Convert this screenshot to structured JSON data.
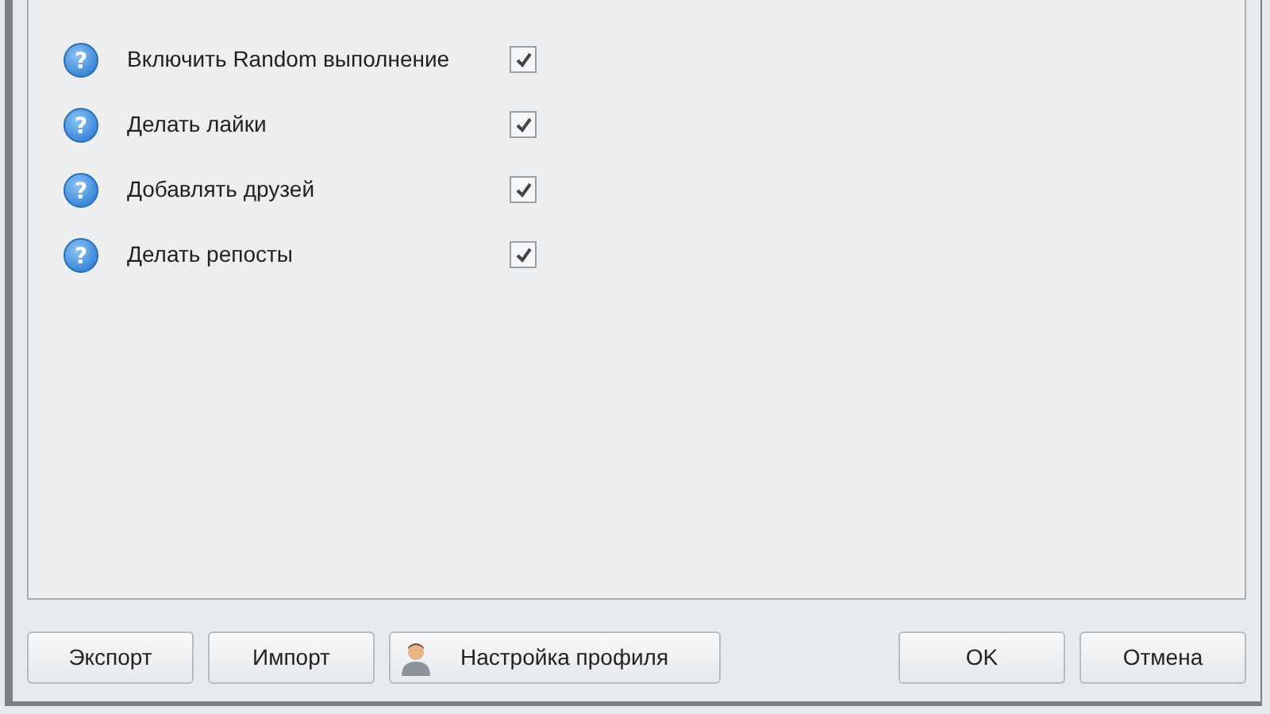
{
  "options": [
    {
      "icon": "?",
      "label": "Включить Random выполнение",
      "checked": true
    },
    {
      "icon": "?",
      "label": "Делать лайки",
      "checked": true
    },
    {
      "icon": "?",
      "label": "Добавлять друзей",
      "checked": true
    },
    {
      "icon": "?",
      "label": "Делать репосты",
      "checked": true
    }
  ],
  "buttons_left": [
    {
      "label": "Экспорт",
      "kind": "plain"
    },
    {
      "label": "Импорт",
      "kind": "plain"
    },
    {
      "label": "Настройка профиля",
      "kind": "profile"
    }
  ],
  "buttons_right": [
    {
      "label": "OK"
    },
    {
      "label": "Отмена"
    }
  ]
}
